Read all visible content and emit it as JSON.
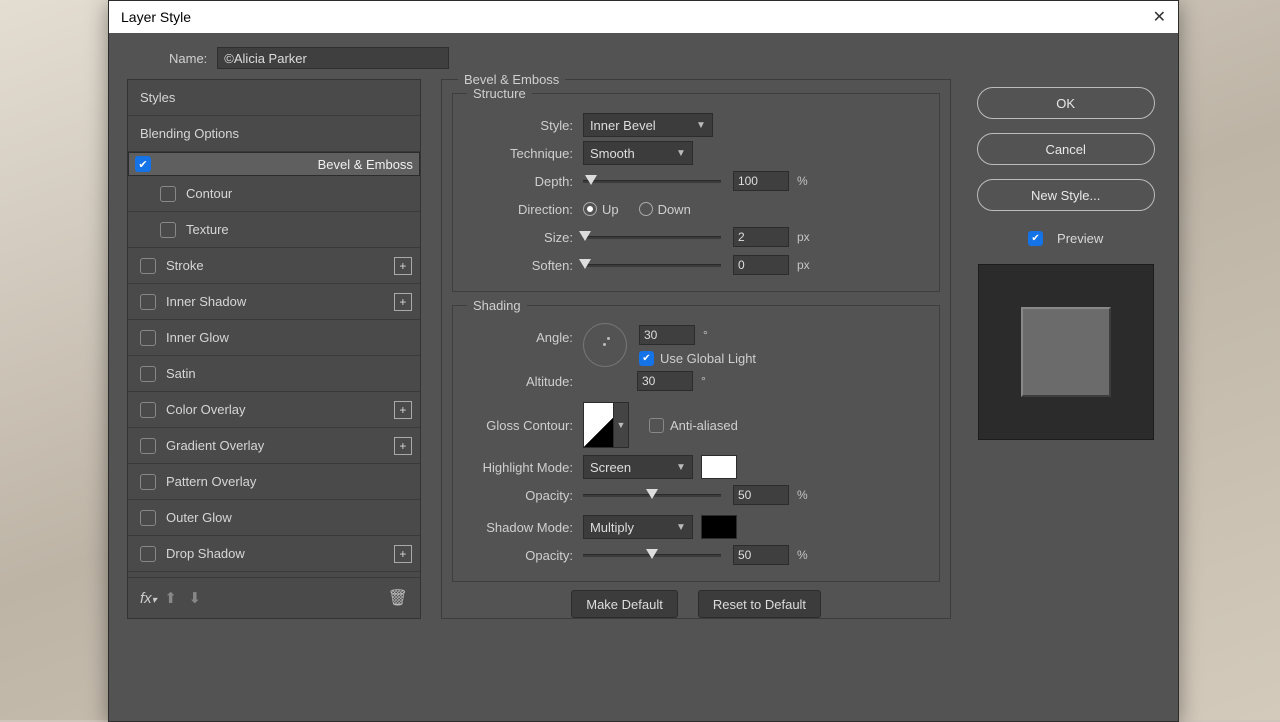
{
  "title": "Layer Style",
  "name_label": "Name:",
  "layer_name": "©Alicia Parker",
  "sidebar": {
    "items": [
      {
        "label": "Styles",
        "hasCheck": false
      },
      {
        "label": "Blending Options",
        "hasCheck": false
      },
      {
        "label": "Bevel & Emboss",
        "hasCheck": true,
        "checked": true,
        "selected": true
      },
      {
        "label": "Contour",
        "hasCheck": true,
        "checked": false,
        "sub": true
      },
      {
        "label": "Texture",
        "hasCheck": true,
        "checked": false,
        "sub": true
      },
      {
        "label": "Stroke",
        "hasCheck": true,
        "checked": false,
        "plus": true
      },
      {
        "label": "Inner Shadow",
        "hasCheck": true,
        "checked": false,
        "plus": true
      },
      {
        "label": "Inner Glow",
        "hasCheck": true,
        "checked": false
      },
      {
        "label": "Satin",
        "hasCheck": true,
        "checked": false
      },
      {
        "label": "Color Overlay",
        "hasCheck": true,
        "checked": false,
        "plus": true
      },
      {
        "label": "Gradient Overlay",
        "hasCheck": true,
        "checked": false,
        "plus": true
      },
      {
        "label": "Pattern Overlay",
        "hasCheck": true,
        "checked": false
      },
      {
        "label": "Outer Glow",
        "hasCheck": true,
        "checked": false
      },
      {
        "label": "Drop Shadow",
        "hasCheck": true,
        "checked": false,
        "plus": true
      }
    ]
  },
  "panel_title": "Bevel & Emboss",
  "structure": {
    "legend": "Structure",
    "style_label": "Style:",
    "style_value": "Inner Bevel",
    "technique_label": "Technique:",
    "technique_value": "Smooth",
    "depth_label": "Depth:",
    "depth_value": "100",
    "depth_unit": "%",
    "direction_label": "Direction:",
    "dir_up": "Up",
    "dir_down": "Down",
    "size_label": "Size:",
    "size_value": "2",
    "size_unit": "px",
    "soften_label": "Soften:",
    "soften_value": "0",
    "soften_unit": "px"
  },
  "shading": {
    "legend": "Shading",
    "angle_label": "Angle:",
    "angle_value": "30",
    "angle_unit": "°",
    "global_light": "Use Global Light",
    "altitude_label": "Altitude:",
    "altitude_value": "30",
    "altitude_unit": "°",
    "gloss_label": "Gloss Contour:",
    "antialiased": "Anti-aliased",
    "highlight_label": "Highlight Mode:",
    "highlight_value": "Screen",
    "highlight_color": "#ffffff",
    "hl_opacity_label": "Opacity:",
    "hl_opacity_value": "50",
    "shadow_label": "Shadow Mode:",
    "shadow_value": "Multiply",
    "shadow_color": "#000000",
    "sh_opacity_label": "Opacity:",
    "sh_opacity_value": "50",
    "pct": "%"
  },
  "btns": {
    "make_default": "Make Default",
    "reset_default": "Reset to Default"
  },
  "right": {
    "ok": "OK",
    "cancel": "Cancel",
    "new_style": "New Style...",
    "preview": "Preview"
  }
}
